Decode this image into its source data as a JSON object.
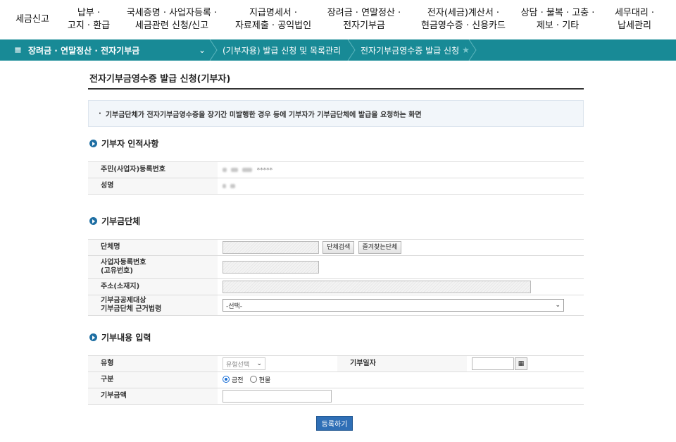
{
  "topnav": [
    {
      "lines": [
        "세금신고"
      ]
    },
    {
      "lines": [
        "납부 ·",
        "고지 · 환급"
      ]
    },
    {
      "lines": [
        "국세증명 · 사업자등록 ·",
        "세금관련 신청/신고"
      ]
    },
    {
      "lines": [
        "지급명세서 ·",
        "자료제출 · 공익법인"
      ]
    },
    {
      "lines": [
        "장려금 · 연말정산 ·",
        "전자기부금"
      ]
    },
    {
      "lines": [
        "전자(세금)계산서 ·",
        "현금영수증 · 신용카드"
      ]
    },
    {
      "lines": [
        "상담 · 불복 · 고충 ·",
        "제보 · 기타"
      ]
    },
    {
      "lines": [
        "세무대리 ·",
        "납세관리"
      ]
    }
  ],
  "breadcrumb": {
    "menu_icon": "≡",
    "menu_label": "장려금 · 연말정산 · 전자기부금",
    "chevron": "⌄",
    "crumb1": "(기부자용) 발급 신청 및 목록관리",
    "crumb2": "전자기부금영수증 발급 신청",
    "favorite_icon": "★"
  },
  "page": {
    "title": "전자기부금영수증 발급 신청(기부자)",
    "notice": "기부금단체가 전자기부금영수증을 장기간 미발행한 경우 등에 기부자가 기부금단체에 발급을 요청하는 화면",
    "notice_bullet": "·"
  },
  "donor_section": {
    "heading": "기부자 인적사항",
    "rows": [
      {
        "label": "주민(사업자)등록번호",
        "masked_suffix": "*****"
      },
      {
        "label": "성명"
      }
    ]
  },
  "org_section": {
    "heading": "기부금단체",
    "name_label": "단체명",
    "search_button": "단체검색",
    "favorites_button": "즐겨찾는단체",
    "bizno_label_1": "사업자등록번호",
    "bizno_label_2": "(고유번호)",
    "address_label": "주소(소재지)",
    "law_label_1": "기부금공제대상",
    "law_label_2": "기부금단체 근거법령",
    "law_select_value": "-선택-"
  },
  "donation_section": {
    "heading": "기부내용 입력",
    "type_label": "유형",
    "type_select_value": "유형선택",
    "date_label": "기부일자",
    "calendar_icon": "▦",
    "category_label": "구분",
    "category_options": [
      "금전",
      "현물"
    ],
    "category_selected": "금전",
    "amount_label": "기부금액"
  },
  "actions": {
    "submit_label": "등록하기"
  }
}
